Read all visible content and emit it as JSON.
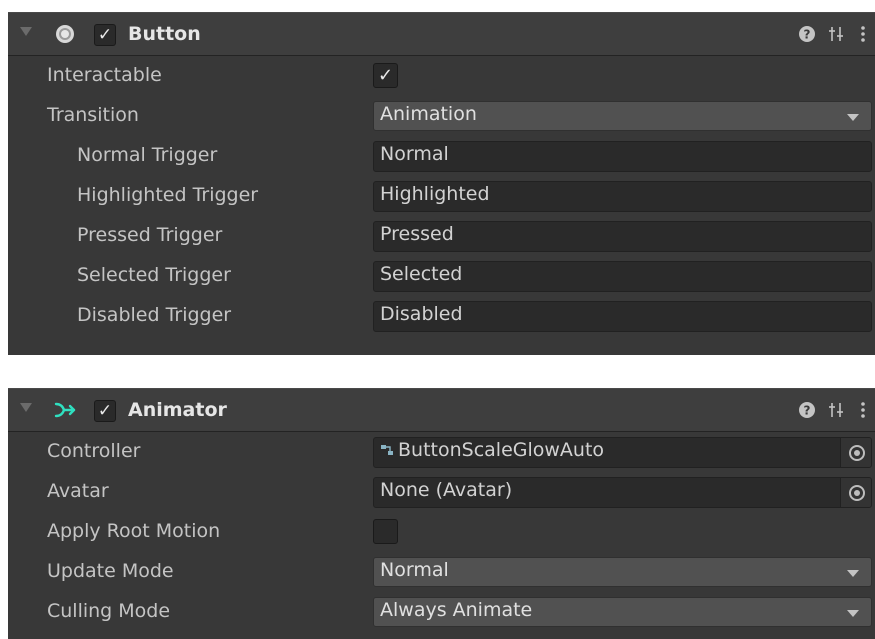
{
  "button_component": {
    "title": "Button",
    "enabled_mark": "✓",
    "interactable_label": "Interactable",
    "interactable_mark": "✓",
    "transition_label": "Transition",
    "transition_value": "Animation",
    "triggers": [
      {
        "label": "Normal Trigger",
        "value": "Normal"
      },
      {
        "label": "Highlighted Trigger",
        "value": "Highlighted"
      },
      {
        "label": "Pressed Trigger",
        "value": "Pressed"
      },
      {
        "label": "Selected Trigger",
        "value": "Selected"
      },
      {
        "label": "Disabled Trigger",
        "value": "Disabled"
      }
    ]
  },
  "animator_component": {
    "title": "Animator",
    "enabled_mark": "✓",
    "controller_label": "Controller",
    "controller_value": "ButtonScaleGlowAuto",
    "avatar_label": "Avatar",
    "avatar_value": "None (Avatar)",
    "apply_root_motion_label": "Apply Root Motion",
    "update_mode_label": "Update Mode",
    "update_mode_value": "Normal",
    "culling_mode_label": "Culling Mode",
    "culling_mode_value": "Always Animate"
  },
  "icons": {
    "help": "?",
    "presets": "⇌",
    "menu": "⋮",
    "controller": "⇆"
  },
  "colors": {
    "panel_bg": "#383838",
    "header_bg": "#3e3e3e",
    "field_bg": "#2a2a2a",
    "dropdown_bg": "#515151",
    "animator_icon": "#2fe0c0"
  }
}
